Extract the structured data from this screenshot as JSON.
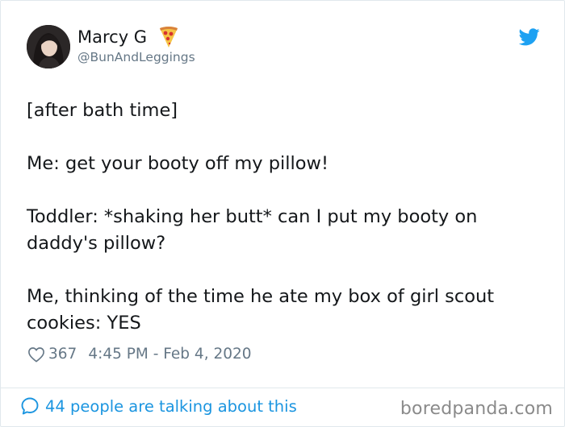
{
  "author": {
    "display_name": "Marcy G",
    "handle": "@BunAndLeggings",
    "badge_icon": "pizza-icon"
  },
  "tweet": {
    "paragraphs": [
      "[after bath time]",
      "Me: get your booty off my pillow!",
      "Toddler: *shaking her butt* can I put my booty on daddy's pillow?",
      "Me, thinking of the time he ate my box of girl scout cookies: YES"
    ],
    "likes": "367",
    "timestamp": "4:45 PM - Feb 4, 2020"
  },
  "footer": {
    "talking_label": "44 people are talking about this",
    "watermark": "boredpanda.com"
  },
  "colors": {
    "twitter_blue": "#1da1f2",
    "link_blue": "#1b95e0",
    "muted_gray": "#657786",
    "text_dark": "#14171a",
    "border": "#e1e8ed"
  },
  "icons": [
    "twitter-bird-icon",
    "heart-icon",
    "speech-bubble-icon",
    "pizza-icon"
  ]
}
